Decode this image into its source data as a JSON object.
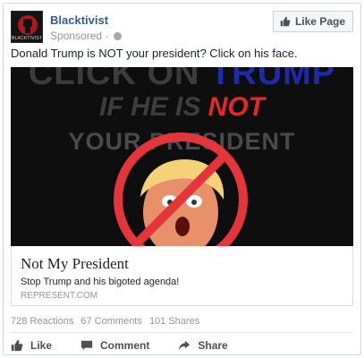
{
  "post": {
    "page_name": "Blacktivist",
    "avatar_text": "BLACKTIVIST",
    "sponsored_label": "Sponsored ·",
    "like_page_label": "Like Page",
    "text": "Donald Trump is NOT your president? Click on his face."
  },
  "ad_image": {
    "line1_a": "CLICK ON ",
    "line1_b": "TRUMP",
    "line2_a": "IF HE IS ",
    "line2_b": "NOT",
    "line3": "YOUR PRESIDENT"
  },
  "link_preview": {
    "title": "Not My President",
    "description": "Stop Trump and his bigoted agenda!",
    "domain": "REPRESENT.COM"
  },
  "counts": {
    "reactions": "728 Reactions",
    "comments": "67 Comments",
    "shares": "101 Shares"
  },
  "actions": {
    "like": "Like",
    "comment": "Comment",
    "share": "Share"
  },
  "colors": {
    "brand_link": "#365899",
    "meta_gray": "#90949c",
    "action_gray": "#4b4f56",
    "ad_red": "#e4272a",
    "ad_blue": "#1e2aa8"
  },
  "icons": [
    "thumbs-up-icon",
    "globe-icon",
    "comment-icon",
    "share-icon"
  ]
}
